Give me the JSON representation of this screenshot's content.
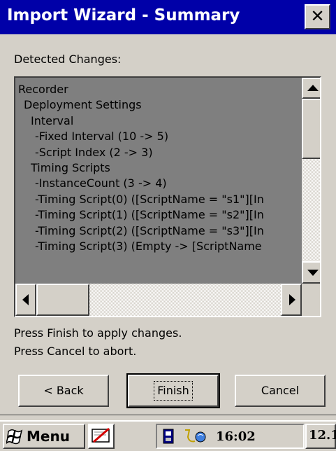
{
  "window": {
    "title": "Import Wizard - Summary",
    "close_icon": "close-icon"
  },
  "detected_label": "Detected Changes:",
  "tree": {
    "rows": [
      {
        "text": "Recorder",
        "level": 0
      },
      {
        "text": "Deployment Settings",
        "level": 1
      },
      {
        "text": "Interval",
        "level": 2
      },
      {
        "text": "-Fixed Interval (10 -> 5)",
        "level": 3
      },
      {
        "text": "-Script Index (2 -> 3)",
        "level": 3
      },
      {
        "text": "Timing Scripts",
        "level": 2
      },
      {
        "text": "-InstanceCount (3 -> 4)",
        "level": 3
      },
      {
        "text": "-Timing Script(0) ([ScriptName = \"s1\"][In",
        "level": 3
      },
      {
        "text": "-Timing Script(1) ([ScriptName = \"s2\"][In",
        "level": 3
      },
      {
        "text": "-Timing Script(2) ([ScriptName = \"s3\"][In",
        "level": 3
      },
      {
        "text": "-Timing Script(3) (Empty -> [ScriptName",
        "level": 3
      }
    ]
  },
  "instructions": {
    "finish": "Press Finish to apply changes.",
    "cancel": "Press Cancel to abort."
  },
  "buttons": {
    "back": "< Back",
    "finish": "Finish",
    "cancel": "Cancel"
  },
  "taskbar": {
    "menu_label": "Menu",
    "time": "16:02",
    "extra": "12.1"
  },
  "colors": {
    "titlebar": "#0000a8",
    "face": "#d4d0c8",
    "listbox": "#7f7f7f"
  }
}
